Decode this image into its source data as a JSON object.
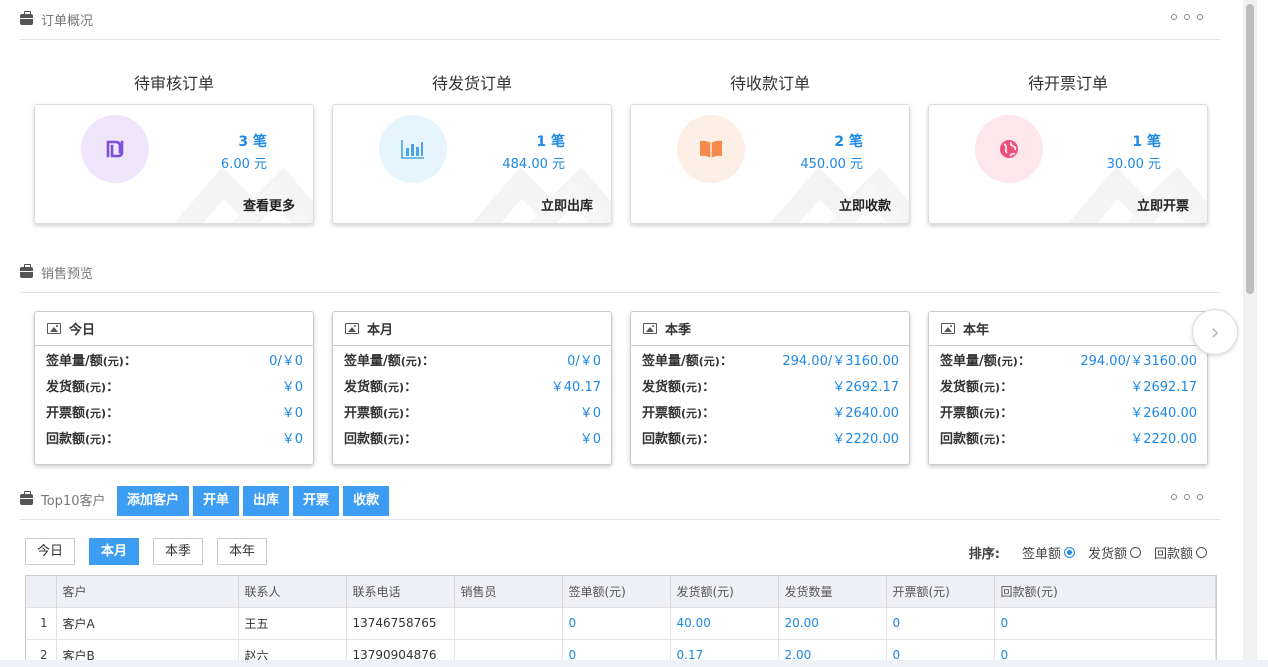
{
  "order_overview": {
    "title": "订单概况",
    "cards": [
      {
        "title": "待审核订单",
        "count": "3 笔",
        "amount": "6.00 元",
        "action": "查看更多",
        "icon": "currency-icon",
        "color": "#7b4fd6",
        "bg": "#efe6fb"
      },
      {
        "title": "待发货订单",
        "count": "1 笔",
        "amount": "484.00 元",
        "action": "立即出库",
        "icon": "bar-chart-icon",
        "color": "#4aa3e6",
        "bg": "#e6f4fd"
      },
      {
        "title": "待收款订单",
        "count": "2 笔",
        "amount": "450.00 元",
        "action": "立即收款",
        "icon": "book-icon",
        "color": "#f58a4b",
        "bg": "#fdeee6"
      },
      {
        "title": "待开票订单",
        "count": "1 笔",
        "amount": "30.00 元",
        "action": "立即开票",
        "icon": "globe-icon",
        "color": "#ef4f7a",
        "bg": "#fde6ec"
      }
    ]
  },
  "sales_preview": {
    "title": "销售预览",
    "row_labels": {
      "sign": "签单量/额",
      "ship": "发货额",
      "invoice": "开票额",
      "payment": "回款额",
      "unit": "(元)",
      "colon": "："
    },
    "cards": [
      {
        "title": "今日",
        "sign": "0/￥0",
        "ship": "￥0",
        "invoice": "￥0",
        "payment": "￥0"
      },
      {
        "title": "本月",
        "sign": "0/￥0",
        "ship": "￥40.17",
        "invoice": "￥0",
        "payment": "￥0"
      },
      {
        "title": "本季",
        "sign": "294.00/￥3160.00",
        "ship": "￥2692.17",
        "invoice": "￥2640.00",
        "payment": "￥2220.00"
      },
      {
        "title": "本年",
        "sign": "294.00/￥3160.00",
        "ship": "￥2692.17",
        "invoice": "￥2640.00",
        "payment": "￥2220.00"
      }
    ],
    "next_glyph": "›"
  },
  "top10": {
    "title": "Top10客户",
    "buttons": [
      "添加客户",
      "开单",
      "出库",
      "开票",
      "收款"
    ],
    "periods": [
      "今日",
      "本月",
      "本季",
      "本年"
    ],
    "active_period": "本月",
    "sort_label": "排序:",
    "sort_options": [
      "签单额",
      "发货额",
      "回款额"
    ],
    "sort_selected": "签单额",
    "columns": [
      "",
      "客户",
      "联系人",
      "联系电话",
      "销售员",
      "签单额(元)",
      "发货额(元)",
      "发货数量",
      "开票额(元)",
      "回款额(元)"
    ],
    "rows": [
      [
        "1",
        "客户A",
        "王五",
        "13746758765",
        "",
        "0",
        "40.00",
        "20.00",
        "0",
        "0"
      ],
      [
        "2",
        "客户B",
        "赵六",
        "13790904876",
        "",
        "0",
        "0.17",
        "2.00",
        "0",
        "0"
      ]
    ]
  },
  "accent_color": "#3d9df3",
  "value_color": "#1e88e5"
}
